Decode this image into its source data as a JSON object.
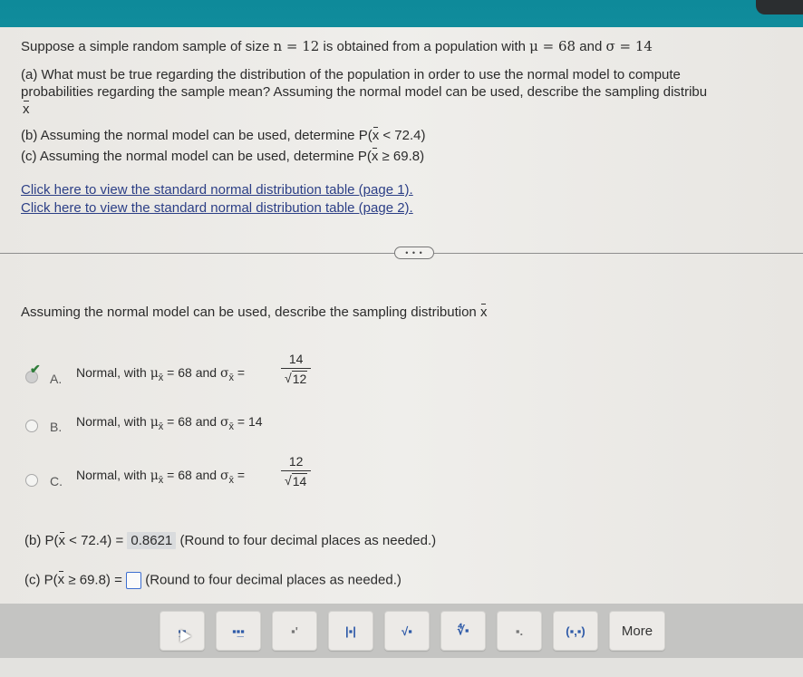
{
  "question": {
    "intro_pre": "Suppose a simple random sample of size ",
    "n_expr": "n = 12",
    "intro_mid": " is obtained from a population with ",
    "mu_expr": "μ = 68",
    "and": " and ",
    "sigma_expr": "σ = 14",
    "part_a_line1": "(a) What must be true regarding the distribution of the population in order to use the normal model to compute",
    "part_a_line2": "probabilities regarding the sample mean? Assuming the normal model can be used, describe the sampling distribu",
    "part_a_line3": "x",
    "part_b_text": "(b) Assuming the normal model can be used, determine P(",
    "part_b_x": "x",
    "part_b_rest": " < 72.4)",
    "part_c_text": "(c) Assuming the normal model can be used, determine P(",
    "part_c_x": "x",
    "part_c_rest": " ≥ 69.8)"
  },
  "links": [
    {
      "label": "Click here to view the standard normal distribution table (page 1)."
    },
    {
      "label": "Click here to view the standard normal distribution table (page 2)."
    }
  ],
  "divider": {
    "expand_label": "• • •"
  },
  "answer_section": {
    "prompt": "Assuming the normal model can be used, describe the sampling distribution ",
    "prompt_x": "x",
    "options": [
      {
        "letter": "A.",
        "text": "Normal, with ",
        "mu": "μ",
        "sub": "x̄",
        "mu_val": " = 68 and ",
        "sigma": "σ",
        "sigma_eq": " = ",
        "numerator": "14",
        "denominator_root": "12",
        "selected": true,
        "correct": true
      },
      {
        "letter": "B.",
        "text": "Normal, with ",
        "mu": "μ",
        "sub": "x̄",
        "mu_val": " = 68 and ",
        "sigma": "σ",
        "sigma_val": " = 14",
        "selected": false
      },
      {
        "letter": "C.",
        "text": "Normal, with ",
        "mu": "μ",
        "sub": "x̄",
        "mu_val": " = 68 and ",
        "sigma": "σ",
        "sigma_eq": " = ",
        "numerator": "12",
        "denominator_root": "14",
        "selected": false
      }
    ],
    "part_b": {
      "label": "(b) P(",
      "x": "x",
      "cond": " < 72.4) = ",
      "value": "0.8621",
      "hint": " (Round to four decimal places as needed.)"
    },
    "part_c": {
      "label": "(c) P(",
      "x": "x",
      "cond": " ≥ 69.8) = ",
      "value": "",
      "hint": " (Round to four decimal places as needed.)"
    }
  },
  "toolbar": {
    "buttons": [
      {
        "name": "fraction",
        "glyph": "▪̲▪"
      },
      {
        "name": "mixed-number",
        "glyph": "▪▪̲▪"
      },
      {
        "name": "exponent",
        "glyph": "▪'"
      },
      {
        "name": "absolute-value",
        "glyph": "|▪|"
      },
      {
        "name": "square-root",
        "glyph": "√▪"
      },
      {
        "name": "nth-root",
        "glyph": "∜▪"
      },
      {
        "name": "subscript-decimal",
        "glyph": "▪."
      },
      {
        "name": "ordered-pair",
        "glyph": "(▪,▪)"
      },
      {
        "name": "more",
        "glyph": "More"
      }
    ]
  },
  "colors": {
    "topbar": "#0e8a9a",
    "link": "#2c3f86",
    "check": "#2f7d3a",
    "toolbar_glyph": "#2e5aa8",
    "answer_box_border": "#3d6ed0"
  }
}
